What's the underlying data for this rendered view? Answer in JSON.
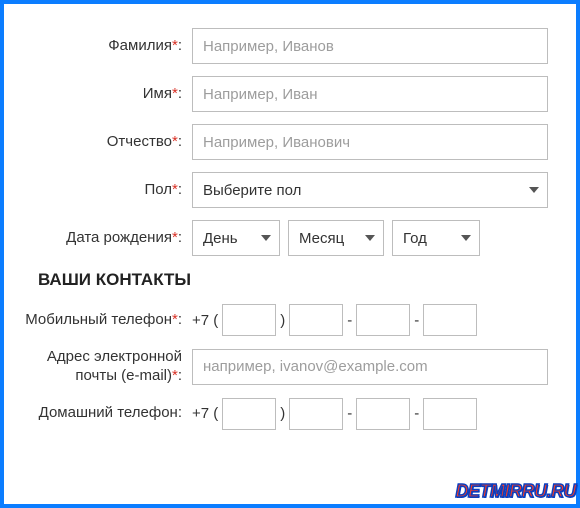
{
  "fields": {
    "lastname": {
      "label": "Фамилия",
      "required": "*",
      "placeholder": "Например, Иванов"
    },
    "firstname": {
      "label": "Имя",
      "required": "*",
      "placeholder": "Например, Иван"
    },
    "patronymic": {
      "label": "Отчество",
      "required": "*",
      "placeholder": "Например, Иванович"
    },
    "gender": {
      "label": "Пол",
      "required": "*",
      "selected": "Выберите пол"
    },
    "birthdate": {
      "label": "Дата рождения",
      "required": "*",
      "day": "День",
      "month": "Месяц",
      "year": "Год"
    }
  },
  "contacts": {
    "title": "ВАШИ КОНТАКТЫ",
    "mobile": {
      "label": "Мобильный телефон",
      "required": "*",
      "prefix": "+7 (",
      "close_paren": ")",
      "dash": "-"
    },
    "email": {
      "label": "Адрес электронной почты (e-mail)",
      "required": "*",
      "placeholder": "например, ivanov@example.com"
    },
    "home": {
      "label": "Домашний телефон",
      "colon": ":",
      "prefix": "+7 (",
      "close_paren": ")",
      "dash": "-"
    }
  },
  "watermark": "DETMIRRU.RU"
}
